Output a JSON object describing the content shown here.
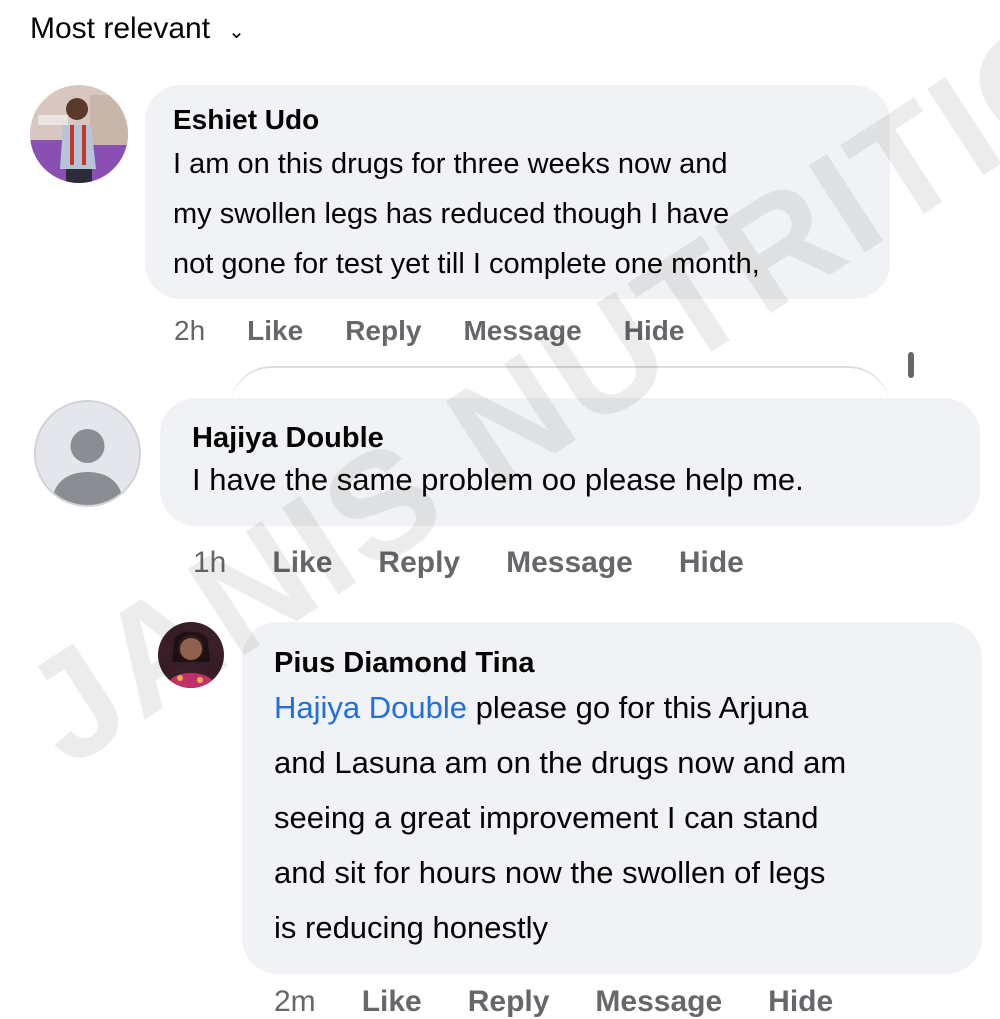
{
  "sort": {
    "label": "Most relevant",
    "icon": "chevron-down-icon"
  },
  "comments": [
    {
      "author": "Eshiet Udo",
      "lines": [
        "I am on this drugs for three weeks now and",
        "my swollen legs has reduced though I have",
        "not gone for test yet till I complete one month,"
      ],
      "time": "2h",
      "actions": [
        "Like",
        "Reply",
        "Message",
        "Hide"
      ]
    },
    {
      "author": "Hajiya Double",
      "lines": [
        "I have the same problem oo please help me."
      ],
      "time": "1h",
      "actions": [
        "Like",
        "Reply",
        "Message",
        "Hide"
      ]
    },
    {
      "author": "Pius Diamond Tina",
      "mention": "Hajiya Double",
      "lines": [
        "please go for this Arjuna",
        "and Lasuna am on the drugs now and am",
        "seeing a great improvement I can stand",
        "and sit for hours now the swollen of legs",
        "is reducing honestly"
      ],
      "time": "2m",
      "actions": [
        "Like",
        "Reply",
        "Message",
        "Hide"
      ]
    }
  ],
  "watermark": "JANIS NUTRITIO",
  "colors": {
    "bubble": "#f0f2f5",
    "mention": "#216fdb",
    "meta": "#65676b"
  }
}
